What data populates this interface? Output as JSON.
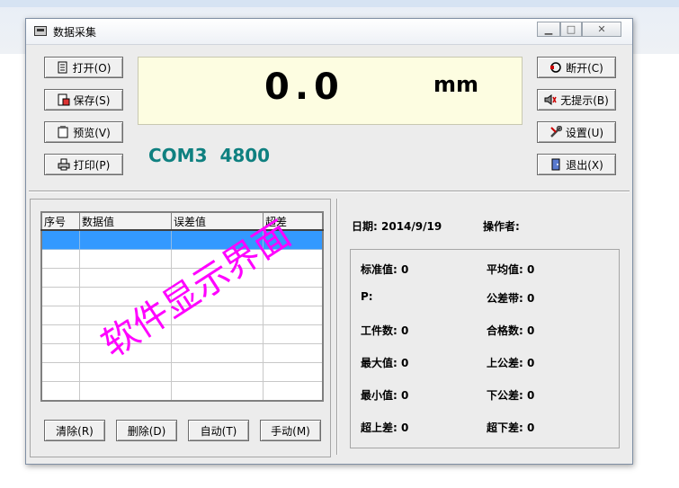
{
  "window": {
    "title": "数据采集"
  },
  "toolbar_left": {
    "open_label": "打开(O)",
    "save_label": "保存(S)",
    "preview_label": "预览(V)",
    "print_label": "打印(P)"
  },
  "toolbar_right": {
    "disconnect_label": "断开(C)",
    "noprompt_label": "无提示(B)",
    "settings_label": "设置(U)",
    "exit_label": "退出(X)"
  },
  "display": {
    "reading": "0.0",
    "unit": "mm"
  },
  "port": {
    "name": "COM3",
    "baud": "4800"
  },
  "table": {
    "headers": [
      "序号",
      "数据值",
      "误差值",
      "超差"
    ],
    "rows": 10
  },
  "bottom_buttons": {
    "clear_label": "清除(R)",
    "delete_label": "删除(D)",
    "auto_label": "自动(T)",
    "manual_label": "手动(M)"
  },
  "info": {
    "date_label": "日期:",
    "date_value": "2014/9/19",
    "operator_label": "操作者:"
  },
  "stats": {
    "standard_label": "标准值:",
    "standard_value": "0",
    "average_label": "平均值:",
    "average_value": "0",
    "p_label": "P:",
    "tolerance_band_label": "公差带:",
    "tolerance_band_value": "0",
    "count_label": "工件数:",
    "count_value": "0",
    "pass_label": "合格数:",
    "pass_value": "0",
    "max_label": "最大值:",
    "max_value": "0",
    "upper_tol_label": "上公差:",
    "upper_tol_value": "0",
    "min_label": "最小值:",
    "min_value": "0",
    "lower_tol_label": "下公差:",
    "lower_tol_value": "0",
    "over_upper_label": "超上差:",
    "over_upper_value": "0",
    "over_lower_label": "超下差:",
    "over_lower_value": "0"
  },
  "watermark": "软件显示界面",
  "colors": {
    "display_bg": "#fdfde1",
    "com_text": "#0f8080",
    "selected_row": "#3399ff",
    "watermark": "#ff00ff"
  }
}
